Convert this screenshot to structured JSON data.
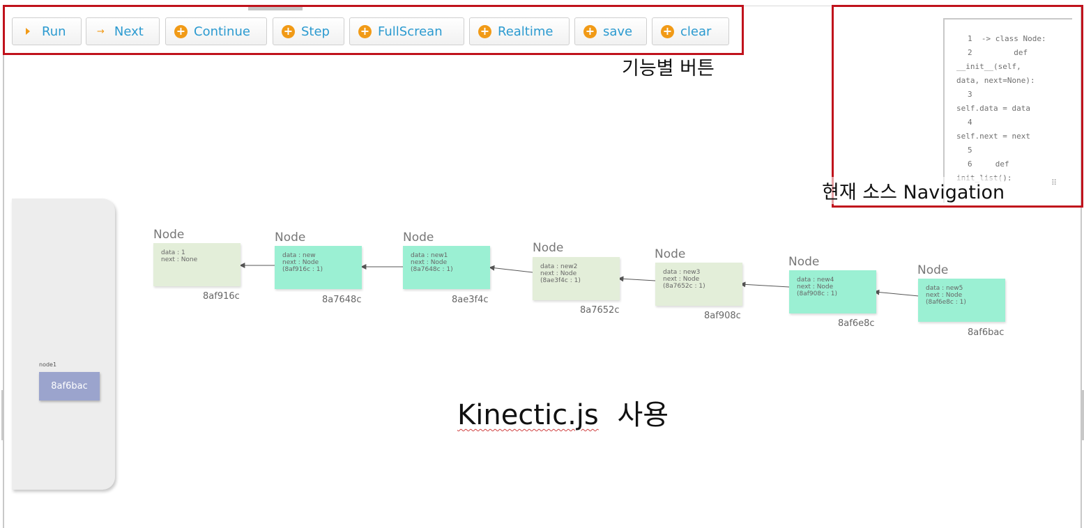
{
  "toolbar": {
    "buttons": [
      {
        "label": "Run",
        "icon": "play-icon"
      },
      {
        "label": "Next",
        "icon": "arrow-right-icon"
      },
      {
        "label": "Continue",
        "icon": "plus-circle-icon"
      },
      {
        "label": "Step",
        "icon": "plus-circle-icon"
      },
      {
        "label": "FullScrean",
        "icon": "plus-circle-icon"
      },
      {
        "label": "Realtime",
        "icon": "plus-circle-icon"
      },
      {
        "label": "save",
        "icon": "plus-circle-icon"
      },
      {
        "label": "clear",
        "icon": "plus-circle-icon"
      }
    ]
  },
  "annotations": {
    "buttons_caption": "기능별 버튼",
    "nav_caption": "현재 소스 Navigation",
    "main_caption_word": "Kinectic.js",
    "main_caption_rest": "사용"
  },
  "code_panel": {
    "lines": [
      "1  -> class Node:",
      "2         def",
      "__init__(self,",
      "data, next=None):",
      "3",
      "self.data = data",
      "4",
      "self.next = next",
      "5",
      "6     def",
      "init_list():"
    ]
  },
  "variables": {
    "label": "node1",
    "value": "8af6bac"
  },
  "nodes": [
    {
      "title": "Node",
      "line1": "data : 1",
      "line2": "next : None",
      "line3": "",
      "addr": "8af916c",
      "color": "#e3eed9"
    },
    {
      "title": "Node",
      "line1": "data : new",
      "line2": "next : Node",
      "line3": "(8af916c : 1)",
      "addr": "8a7648c",
      "color": "#9bf0d3"
    },
    {
      "title": "Node",
      "line1": "data : new1",
      "line2": "next : Node",
      "line3": "(8a7648c : 1)",
      "addr": "8ae3f4c",
      "color": "#9bf0d3"
    },
    {
      "title": "Node",
      "line1": "data : new2",
      "line2": "next : Node",
      "line3": "(8ae3f4c : 1)",
      "addr": "8a7652c",
      "color": "#e3eed9"
    },
    {
      "title": "Node",
      "line1": "data : new3",
      "line2": "next : Node",
      "line3": "(8a7652c : 1)",
      "addr": "8af908c",
      "color": "#e3eed9"
    },
    {
      "title": "Node",
      "line1": "data : new4",
      "line2": "next : Node",
      "line3": "(8af908c : 1)",
      "addr": "8af6e8c",
      "color": "#9bf0d3"
    },
    {
      "title": "Node",
      "line1": "data : new5",
      "line2": "next : Node",
      "line3": "(8af6e8c : 1)",
      "addr": "8af6bac",
      "color": "#9bf0d3"
    }
  ],
  "colors": {
    "accent": "#2b9ad0",
    "icon_orange": "#f19a16",
    "highlight_box": "#c0121c",
    "variable_box": "#9ba4cd"
  }
}
